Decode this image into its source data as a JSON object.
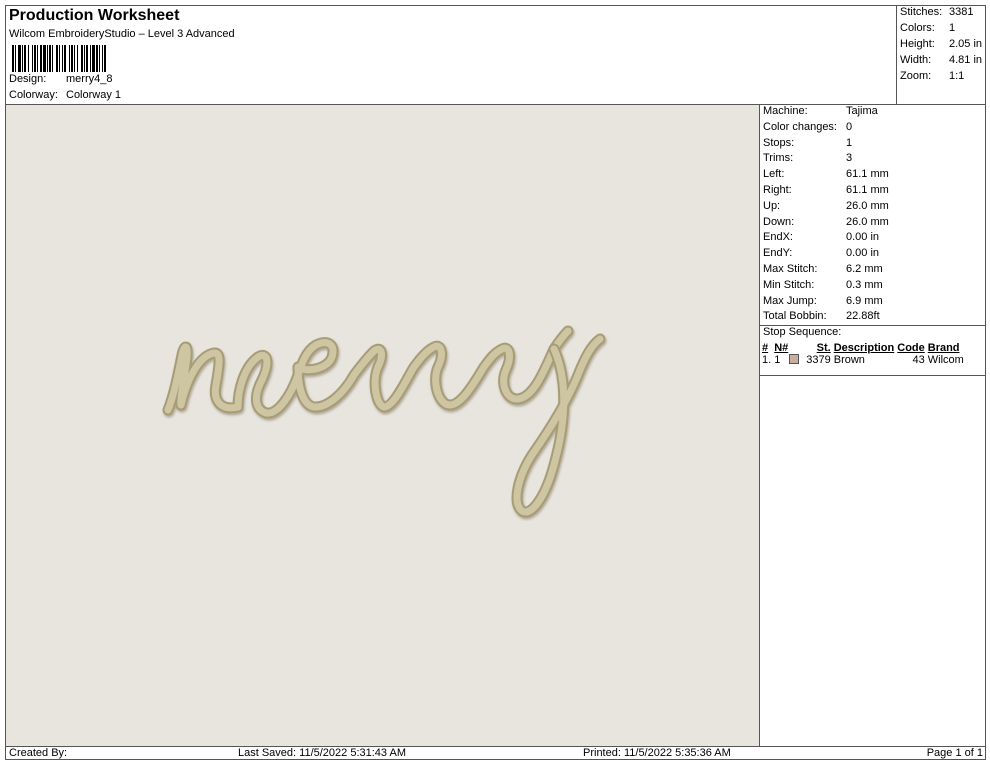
{
  "header": {
    "title": "Production Worksheet",
    "subtitle": "Wilcom EmbroideryStudio – Level 3 Advanced",
    "design_label": "Design:",
    "design_value": "merry4_8",
    "colorway_label": "Colorway:",
    "colorway_value": "Colorway 1"
  },
  "summary": [
    {
      "label": "Stitches:",
      "value": "3381"
    },
    {
      "label": "Colors:",
      "value": "1"
    },
    {
      "label": "Height:",
      "value": "2.05 in"
    },
    {
      "label": "Width:",
      "value": "4.81 in"
    },
    {
      "label": "Zoom:",
      "value": "1:1"
    }
  ],
  "details": [
    {
      "label": "Machine:",
      "value": "Tajima"
    },
    {
      "label": "Color changes:",
      "value": "0"
    },
    {
      "label": "Stops:",
      "value": "1"
    },
    {
      "label": "Trims:",
      "value": "3"
    },
    {
      "label": "Left:",
      "value": "61.1 mm"
    },
    {
      "label": "Right:",
      "value": "61.1 mm"
    },
    {
      "label": "Up:",
      "value": "26.0 mm"
    },
    {
      "label": "Down:",
      "value": "26.0 mm"
    },
    {
      "label": "EndX:",
      "value": "0.00 in"
    },
    {
      "label": "EndY:",
      "value": "0.00 in"
    },
    {
      "label": "Max Stitch:",
      "value": "6.2 mm"
    },
    {
      "label": "Min Stitch:",
      "value": "0.3 mm"
    },
    {
      "label": "Max Jump:",
      "value": "6.9 mm"
    },
    {
      "label": "Total Bobbin:",
      "value": "22.88ft"
    }
  ],
  "stop_sequence": {
    "title": "Stop Sequence:",
    "headers": [
      "#",
      "N#",
      "St.",
      "Description",
      "Code",
      "Brand"
    ],
    "rows": [
      {
        "num": "1.",
        "n": "1",
        "swatch_color": "#c9ad9e",
        "st": "3379",
        "description": "Brown",
        "code": "43",
        "brand": "Wilcom"
      }
    ]
  },
  "footer": {
    "created_by": "Created By:",
    "last_saved": "Last Saved: 11/5/2022 5:31:43 AM",
    "printed": "Printed: 11/5/2022 5:35:36 AM",
    "page": "Page 1 of 1"
  },
  "colors": {
    "design_background": "#e8e5df",
    "thread": "#c9bf9b"
  }
}
